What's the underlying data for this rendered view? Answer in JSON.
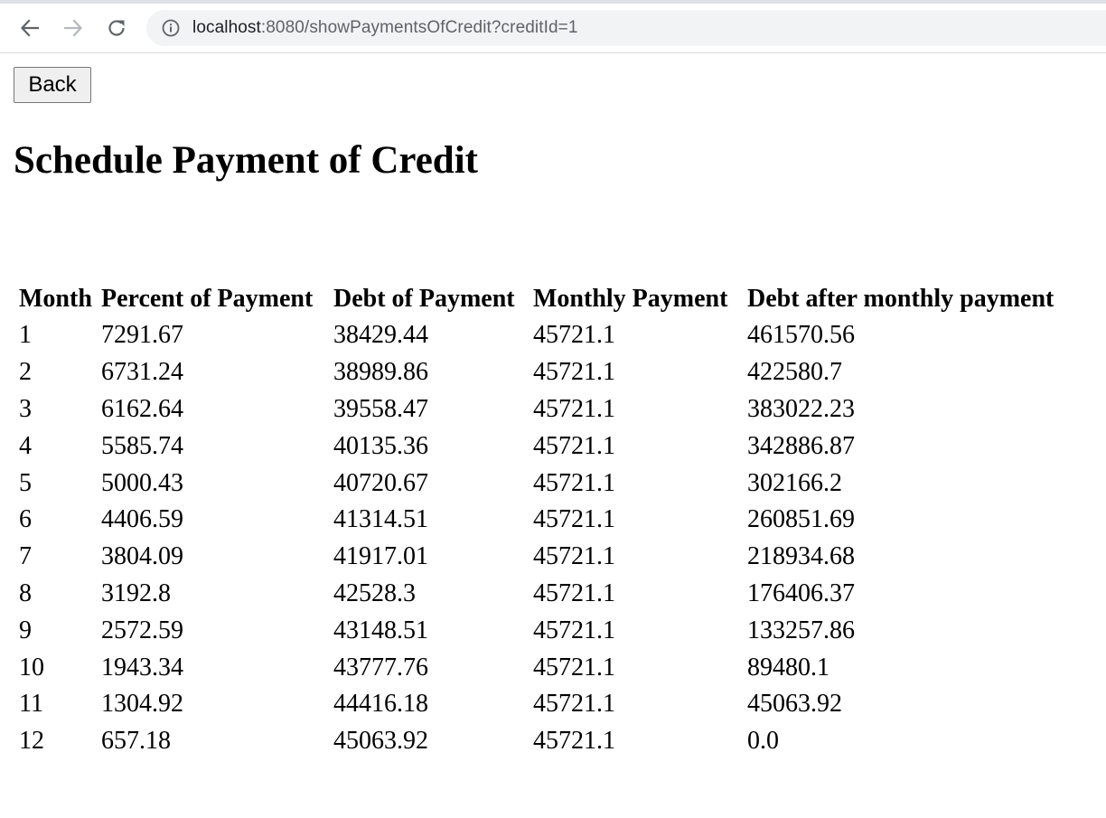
{
  "browser": {
    "url_host": "localhost",
    "url_rest": ":8080/showPaymentsOfCredit?creditId=1",
    "back_icon": "arrow-left-icon",
    "forward_icon": "arrow-right-icon",
    "reload_icon": "reload-icon",
    "info_icon": "info-icon"
  },
  "page": {
    "back_label": "Back",
    "title": "Schedule Payment of Credit"
  },
  "table": {
    "headers": [
      "Month",
      "Percent of Payment",
      "Debt of Payment",
      "Monthly Payment",
      "Debt after monthly payment"
    ],
    "rows": [
      [
        "1",
        "7291.67",
        "38429.44",
        "45721.1",
        "461570.56"
      ],
      [
        "2",
        "6731.24",
        "38989.86",
        "45721.1",
        "422580.7"
      ],
      [
        "3",
        "6162.64",
        "39558.47",
        "45721.1",
        "383022.23"
      ],
      [
        "4",
        "5585.74",
        "40135.36",
        "45721.1",
        "342886.87"
      ],
      [
        "5",
        "5000.43",
        "40720.67",
        "45721.1",
        "302166.2"
      ],
      [
        "6",
        "4406.59",
        "41314.51",
        "45721.1",
        "260851.69"
      ],
      [
        "7",
        "3804.09",
        "41917.01",
        "45721.1",
        "218934.68"
      ],
      [
        "8",
        "3192.8",
        "42528.3",
        "45721.1",
        "176406.37"
      ],
      [
        "9",
        "2572.59",
        "43148.51",
        "45721.1",
        "133257.86"
      ],
      [
        "10",
        "1943.34",
        "43777.76",
        "45721.1",
        "89480.1"
      ],
      [
        "11",
        "1304.92",
        "44416.18",
        "45721.1",
        "45063.92"
      ],
      [
        "12",
        "657.18",
        "45063.92",
        "45721.1",
        "0.0"
      ]
    ]
  }
}
